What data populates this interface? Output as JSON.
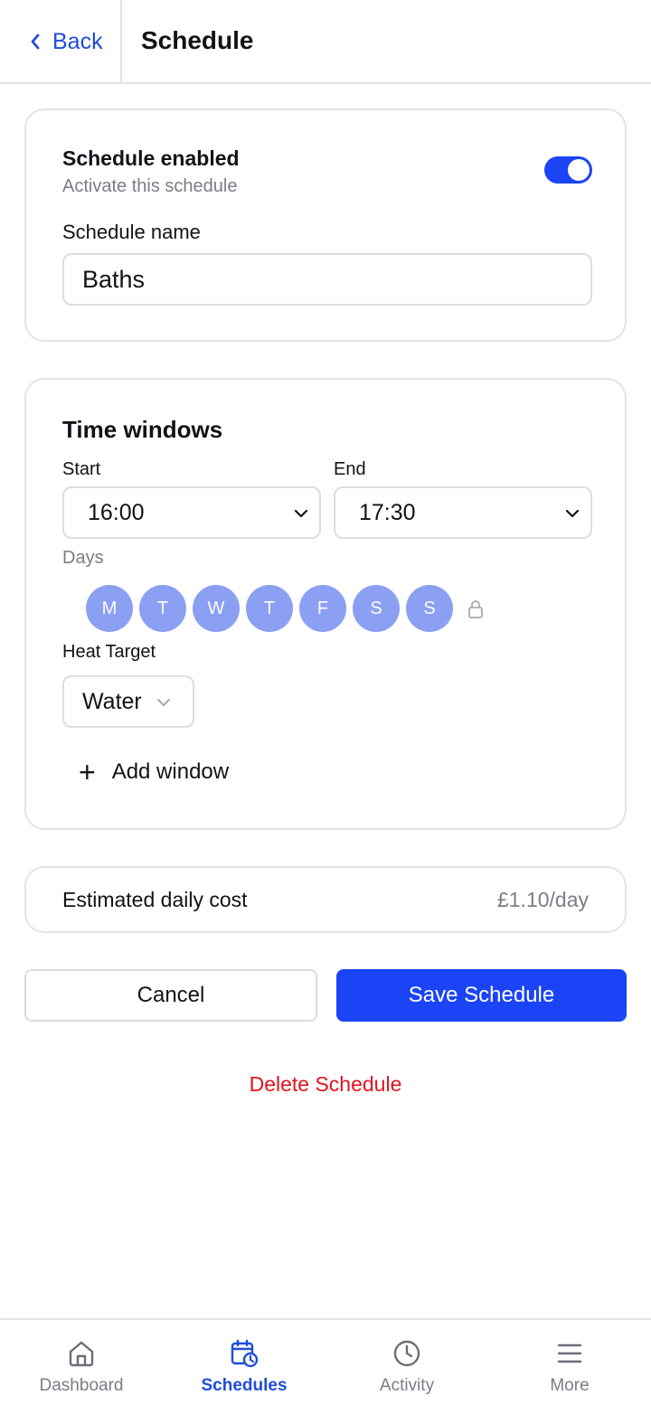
{
  "header": {
    "back_label": "Back",
    "title": "Schedule"
  },
  "enabled_card": {
    "title": "Schedule enabled",
    "subtitle": "Activate this schedule",
    "toggle_on": true,
    "name_label": "Schedule name",
    "name_value": "Baths"
  },
  "time_windows": {
    "title": "Time windows",
    "start_label": "Start",
    "start_value": "16:00",
    "end_label": "End",
    "end_value": "17:30",
    "days_label": "Days",
    "days": [
      "M",
      "T",
      "W",
      "T",
      "F",
      "S",
      "S"
    ],
    "heat_target_label": "Heat Target",
    "heat_target_value": "Water",
    "add_window_label": "Add window"
  },
  "cost": {
    "label": "Estimated daily cost",
    "value": "£1.10/day"
  },
  "actions": {
    "cancel_label": "Cancel",
    "save_label": "Save Schedule",
    "delete_label": "Delete Schedule"
  },
  "bottom_nav": {
    "items": [
      {
        "label": "Dashboard",
        "icon": "home-icon"
      },
      {
        "label": "Schedules",
        "icon": "calendar-clock-icon",
        "active": true
      },
      {
        "label": "Activity",
        "icon": "clock-icon"
      },
      {
        "label": "More",
        "icon": "menu-icon"
      }
    ]
  },
  "colors": {
    "accent": "#1a44f5",
    "day_chip": "#8b9ff3",
    "danger": "#e0141e",
    "muted": "#7a7d86",
    "border": "#e3e4e8"
  }
}
